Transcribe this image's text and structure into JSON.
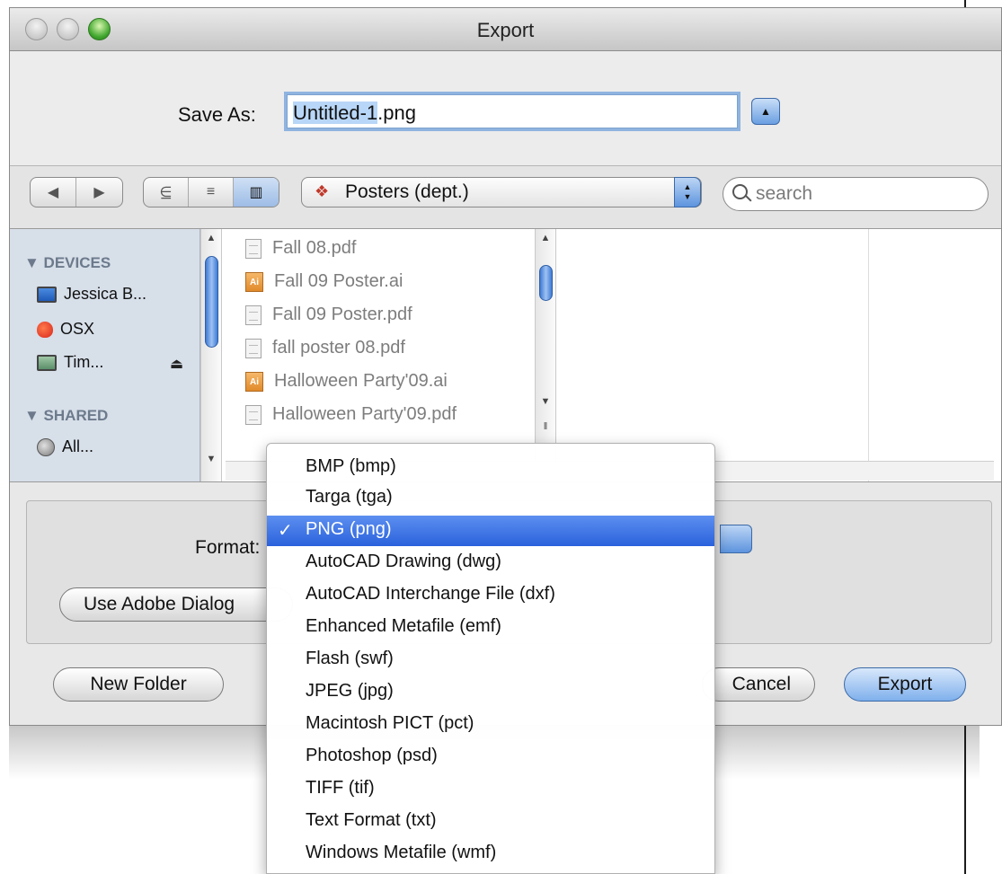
{
  "window": {
    "title": "Export"
  },
  "save_as": {
    "label": "Save As:",
    "value_selected": "Untitled-1",
    "value_rest": ".png",
    "expand_icon": "triangle-up-icon"
  },
  "toolbar": {
    "back_icon": "◀",
    "forward_icon": "▶",
    "view_icons": "⋸",
    "view_list": "≡",
    "view_columns": "▥",
    "location": "Posters (dept.)",
    "search_placeholder": "search"
  },
  "sidebar": {
    "devices_header": "▼ DEVICES",
    "shared_header": "▼ SHARED",
    "devices": [
      "Jessica B...",
      "OSX",
      "Tim..."
    ],
    "shared": [
      "All..."
    ],
    "eject_icon": "⏏"
  },
  "files": [
    {
      "name": "Fall 08.pdf",
      "kind": "pdf"
    },
    {
      "name": "Fall 09 Poster.ai",
      "kind": "ai"
    },
    {
      "name": "Fall 09 Poster.pdf",
      "kind": "pdf"
    },
    {
      "name": "fall poster 08.pdf",
      "kind": "pdf"
    },
    {
      "name": "Halloween Party'09.ai",
      "kind": "ai"
    },
    {
      "name": "Halloween Party'09.pdf",
      "kind": "pdf"
    }
  ],
  "ai_badge": "Ai",
  "format": {
    "label": "Format:",
    "options": [
      "BMP (bmp)",
      "Targa (tga)",
      "PNG (png)",
      "AutoCAD Drawing (dwg)",
      "AutoCAD Interchange File (dxf)",
      "Enhanced Metafile (emf)",
      "Flash (swf)",
      "JPEG (jpg)",
      "Macintosh PICT (pct)",
      "Photoshop (psd)",
      "TIFF (tif)",
      "Text Format (txt)",
      "Windows Metafile (wmf)"
    ],
    "selected_index": 2,
    "check": "✓"
  },
  "buttons": {
    "adobe_dialog": "Use Adobe Dialog",
    "new_folder": "New Folder",
    "cancel": "Cancel",
    "export": "Export"
  },
  "colors": {
    "selection_blue": "#2a62dc",
    "aqua_blue": "#5d94de",
    "zoom_green": "#3ea52c"
  }
}
